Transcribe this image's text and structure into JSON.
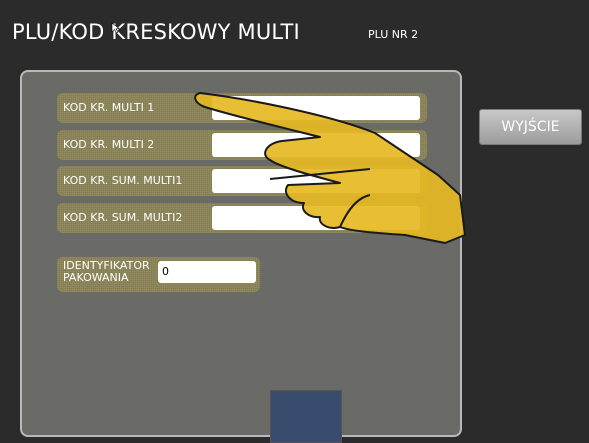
{
  "header": {
    "title": "PLU/KOD KRESKOWY MULTI",
    "plu_nr": "PLU NR 2"
  },
  "form": {
    "rows": [
      {
        "label": "KOD KR. MULTI 1",
        "value": ""
      },
      {
        "label": "KOD KR. MULTI 2",
        "value": ""
      },
      {
        "label": "KOD KR. SUM. MULTI1",
        "value": ""
      },
      {
        "label": "KOD KR. SUM. MULTI2",
        "value": ""
      }
    ],
    "packaging": {
      "label": "IDENTYFIKATOR PAKOWANIA",
      "value": "0"
    }
  },
  "buttons": {
    "exit_label": "WYJŚCIE"
  },
  "colors": {
    "background": "#2b2b2b",
    "panel": "#6a6b66",
    "row": "#8b8457",
    "hand": "#e6b824"
  },
  "icons": [
    "cursor-arrow-icon",
    "pointing-hand-icon"
  ]
}
